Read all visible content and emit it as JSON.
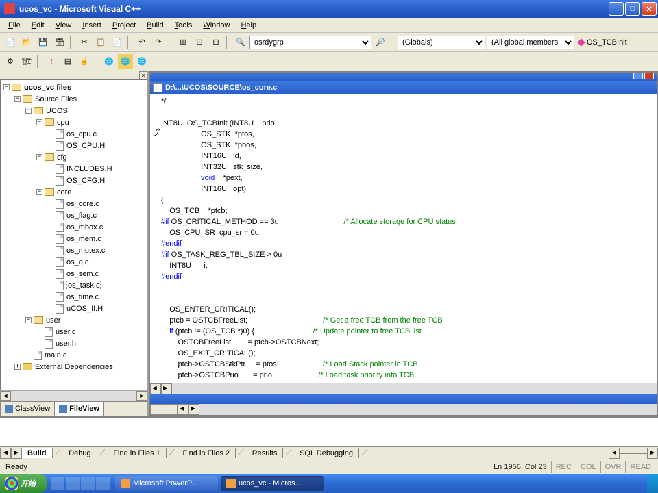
{
  "window": {
    "title": "ucos_vc - Microsoft Visual C++"
  },
  "menu": [
    "File",
    "Edit",
    "View",
    "Insert",
    "Project",
    "Build",
    "Tools",
    "Window",
    "Help"
  ],
  "toolbar": {
    "combo1": "osrdygrp",
    "combo2": "(Globals)",
    "combo3": "(All global members",
    "func": "OS_TCBInit"
  },
  "tree": {
    "root": "ucos_vc files",
    "source_files": "Source Files",
    "ucos": "UCOS",
    "cpu": "cpu",
    "cpu_files": [
      "os_cpu.c",
      "OS_CPU.H"
    ],
    "cfg": "cfg",
    "cfg_files": [
      "INCLUDES.H",
      "OS_CFG.H"
    ],
    "core": "core",
    "core_files": [
      "os_core.c",
      "os_flag.c",
      "os_mbox.c",
      "os_mem.c",
      "os_mutex.c",
      "os_q.c",
      "os_sem.c",
      "os_task.c",
      "os_time.c",
      "uCOS_II.H"
    ],
    "user": "user",
    "user_files": [
      "user.c",
      "user.h"
    ],
    "main": "main.c",
    "ext": "External Dependencies"
  },
  "left_tabs": {
    "class": "ClassView",
    "file": "FileView"
  },
  "doc": {
    "path": "D:\\...\\UCOS\\SOURCE\\os_core.c"
  },
  "code": {
    "l00": "*/",
    "l01": "",
    "l02": "INT8U  OS_TCBInit (INT8U    prio,",
    "l03": "                   OS_STK  *ptos,",
    "l04": "                   OS_STK  *pbos,",
    "l05": "                   INT16U   id,",
    "l06": "                   INT32U   stk_size,",
    "l07a": "                   ",
    "l07b": "void",
    "l07c": "    *pext,",
    "l08": "                   INT16U   opt)",
    "l09": "{",
    "l10": "    OS_TCB    *ptcb;",
    "l11a": "#if",
    "l11b": " OS_CRITICAL_METHOD == 3u",
    "l11c": "                               ",
    "l11cm": "/* Allocate storage for CPU status",
    "l12": "    OS_CPU_SR  cpu_sr = 0u;",
    "l13": "#endif",
    "l14a": "#if",
    "l14b": " OS_TASK_REG_TBL_SIZE > 0u",
    "l15": "    INT8U      i;",
    "l16": "#endif",
    "l17": "",
    "l18": "",
    "l19": "    OS_ENTER_CRITICAL();",
    "l20a": "    ptcb = OSTCBFreeList;",
    "l20s": "                                    ",
    "l20c": "/* Get a free TCB from the free TCB",
    "l21a": "    ",
    "l21b": "if",
    "l21c": " (ptcb != (OS_TCB *)0) {",
    "l21s": "                            ",
    "l21cm": "/* Update pointer to free TCB list",
    "l22": "        OSTCBFreeList        = ptcb->OSTCBNext;",
    "l23": "        OS_EXIT_CRITICAL();",
    "l24a": "        ptcb->OSTCBStkPtr     = ptos;",
    "l24s": "                     ",
    "l24c": "/* Load Stack pointer in TCB",
    "l25a": "        ptcb->OSTCBPrio       = prio;",
    "l25s": "                     ",
    "l25c": "/* Load task priority into TCB"
  },
  "output_tabs": {
    "build": "Build",
    "debug": "Debug",
    "f1": "Find in Files 1",
    "f2": "Find in Files 2",
    "res": "Results",
    "sql": "SQL Debugging"
  },
  "status": {
    "ready": "Ready",
    "pos": "Ln 1956, Col 23",
    "rec": "REC",
    "col": "COL",
    "ovr": "OVR",
    "read": "READ"
  },
  "taskbar": {
    "start": "开始",
    "t1": "Microsoft PowerP...",
    "t2": "ucos_vc - Micros..."
  }
}
